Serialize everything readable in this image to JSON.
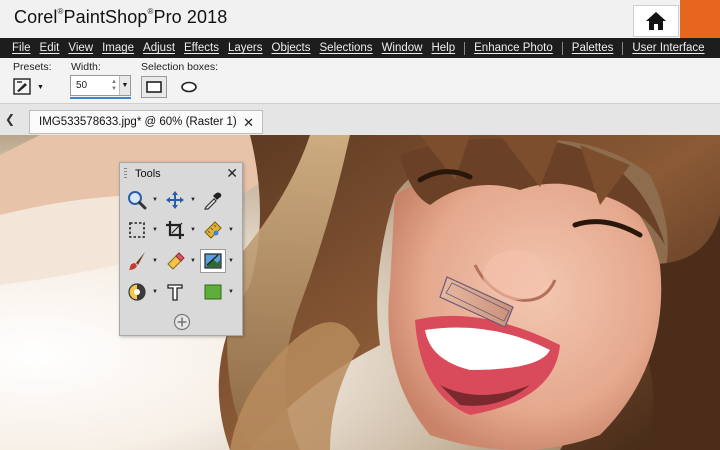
{
  "app": {
    "brand_corel": "Corel",
    "brand_psp": "PaintShop",
    "brand_pro": "Pro 2018",
    "reg_mark": "®"
  },
  "menu": {
    "items": [
      "File",
      "Edit",
      "View",
      "Image",
      "Adjust",
      "Effects",
      "Layers",
      "Objects",
      "Selections",
      "Window",
      "Help",
      "Enhance Photo",
      "Palettes",
      "User Interface"
    ]
  },
  "options": {
    "presets_label": "Presets:",
    "width_label": "Width:",
    "width_value": "50",
    "selection_boxes_label": "Selection boxes:"
  },
  "document_tab": {
    "label": "IMG533578633.jpg* @  60% (Raster 1)",
    "close_glyph": "✕"
  },
  "tools_palette": {
    "title": "Tools",
    "close_glyph": "✕"
  },
  "icons": {
    "home": "home-icon",
    "preset": "preset-icon",
    "zoom": "zoom-icon",
    "move": "move-icon",
    "eyedropper": "eyedropper-icon",
    "selection": "selection-icon",
    "crop": "crop-icon",
    "straighten": "straighten-icon",
    "paintbrush": "paintbrush-icon",
    "eraser": "eraser-icon",
    "perspective": "perspective-correction-icon",
    "fill": "fill-icon",
    "text": "text-icon",
    "shape": "rectangle-shape-icon",
    "add": "add-tool-icon"
  },
  "colors": {
    "accent_orange": "#e8651f",
    "menubar_bg": "#1d1d1d",
    "width_focus": "#3b86d6"
  }
}
